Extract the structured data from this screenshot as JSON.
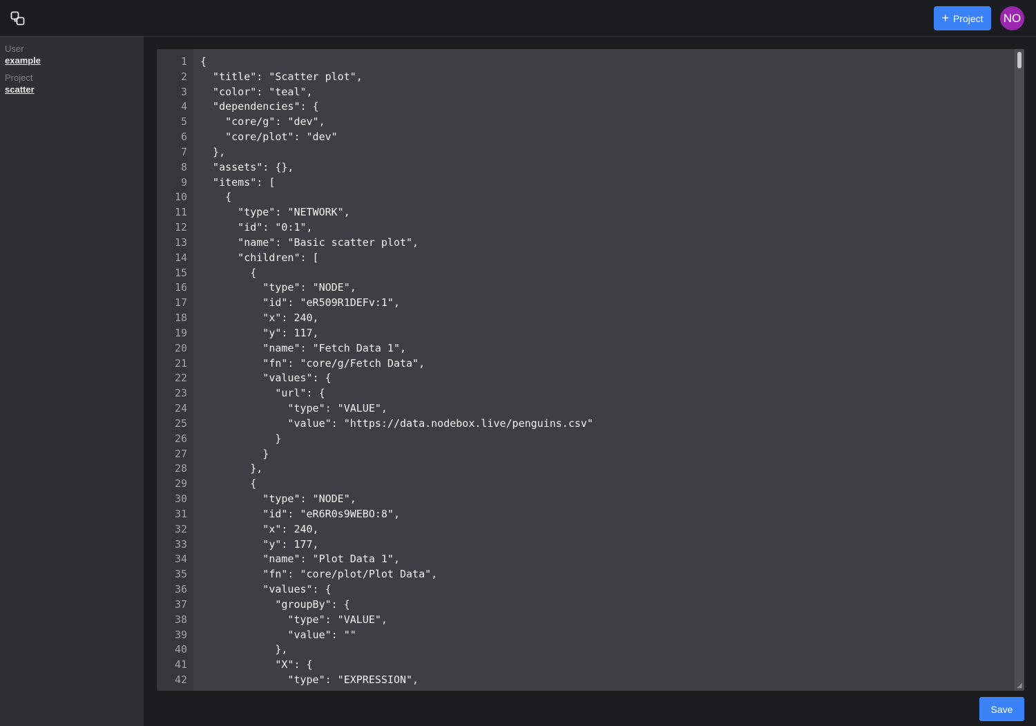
{
  "header": {
    "logo_icon": "nodebox-logo-icon",
    "new_project_label": "Project",
    "new_project_icon": "plus-icon",
    "avatar_initials": "NO",
    "avatar_color": "#9b27b0",
    "accent_color": "#3b82f6"
  },
  "sidebar": {
    "user_label": "User",
    "user_value": "example",
    "project_label": "Project",
    "project_value": "scatter"
  },
  "editor": {
    "lines": [
      {
        "n": "1",
        "text": "{"
      },
      {
        "n": "2",
        "text": "  \"title\": \"Scatter plot\","
      },
      {
        "n": "3",
        "text": "  \"color\": \"teal\","
      },
      {
        "n": "4",
        "text": "  \"dependencies\": {"
      },
      {
        "n": "5",
        "text": "    \"core/g\": \"dev\","
      },
      {
        "n": "6",
        "text": "    \"core/plot\": \"dev\""
      },
      {
        "n": "7",
        "text": "  },"
      },
      {
        "n": "8",
        "text": "  \"assets\": {},"
      },
      {
        "n": "9",
        "text": "  \"items\": ["
      },
      {
        "n": "10",
        "text": "    {"
      },
      {
        "n": "11",
        "text": "      \"type\": \"NETWORK\","
      },
      {
        "n": "12",
        "text": "      \"id\": \"0:1\","
      },
      {
        "n": "13",
        "text": "      \"name\": \"Basic scatter plot\","
      },
      {
        "n": "14",
        "text": "      \"children\": ["
      },
      {
        "n": "15",
        "text": "        {"
      },
      {
        "n": "16",
        "text": "          \"type\": \"NODE\","
      },
      {
        "n": "17",
        "text": "          \"id\": \"eR509R1DEFv:1\","
      },
      {
        "n": "18",
        "text": "          \"x\": 240,"
      },
      {
        "n": "19",
        "text": "          \"y\": 117,"
      },
      {
        "n": "20",
        "text": "          \"name\": \"Fetch Data 1\","
      },
      {
        "n": "21",
        "text": "          \"fn\": \"core/g/Fetch Data\","
      },
      {
        "n": "22",
        "text": "          \"values\": {"
      },
      {
        "n": "23",
        "text": "            \"url\": {"
      },
      {
        "n": "24",
        "text": "              \"type\": \"VALUE\","
      },
      {
        "n": "25",
        "text": "              \"value\": \"https://data.nodebox.live/penguins.csv\""
      },
      {
        "n": "26",
        "text": "            }"
      },
      {
        "n": "27",
        "text": "          }"
      },
      {
        "n": "28",
        "text": "        },"
      },
      {
        "n": "29",
        "text": "        {"
      },
      {
        "n": "30",
        "text": "          \"type\": \"NODE\","
      },
      {
        "n": "31",
        "text": "          \"id\": \"eR6R0s9WEBO:8\","
      },
      {
        "n": "32",
        "text": "          \"x\": 240,"
      },
      {
        "n": "33",
        "text": "          \"y\": 177,"
      },
      {
        "n": "34",
        "text": "          \"name\": \"Plot Data 1\","
      },
      {
        "n": "35",
        "text": "          \"fn\": \"core/plot/Plot Data\","
      },
      {
        "n": "36",
        "text": "          \"values\": {"
      },
      {
        "n": "37",
        "text": "            \"groupBy\": {"
      },
      {
        "n": "38",
        "text": "              \"type\": \"VALUE\","
      },
      {
        "n": "39",
        "text": "              \"value\": \"\""
      },
      {
        "n": "40",
        "text": "            },"
      },
      {
        "n": "41",
        "text": "            \"X\": {"
      },
      {
        "n": "42",
        "text": "              \"type\": \"EXPRESSION\","
      }
    ]
  },
  "footer": {
    "save_label": "Save"
  }
}
